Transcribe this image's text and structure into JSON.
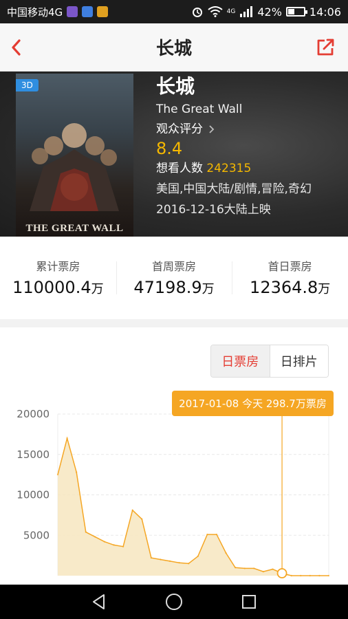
{
  "status_bar": {
    "carrier": "中国移动4G",
    "network": "4G",
    "battery": "42%",
    "battery_level": 0.42,
    "time": "14:06"
  },
  "nav": {
    "title": "长城"
  },
  "movie": {
    "badge": "3D",
    "poster_title": "THE GREAT WALL",
    "title_cn": "长城",
    "title_en": "The Great Wall",
    "rating_label": "观众评分",
    "rating": "8.4",
    "want_label": "想看人数",
    "want_count": "242315",
    "genre": "美国,中国大陆/剧情,冒险,奇幻",
    "release": "2016-12-16大陆上映"
  },
  "stats": [
    {
      "label": "累计票房",
      "value": "110000.4",
      "unit": "万"
    },
    {
      "label": "首周票房",
      "value": "47198.9",
      "unit": "万"
    },
    {
      "label": "首日票房",
      "value": "12364.8",
      "unit": "万"
    }
  ],
  "tabs": {
    "daily_box": "日票房",
    "daily_schedule": "日排片"
  },
  "tooltip": "2017-01-08 今天 298.7万票房",
  "colors": {
    "accent": "#e43d33",
    "rating": "#f5b800",
    "chart_line": "#f5a623",
    "chart_fill": "#f7e6bf"
  },
  "chart_data": {
    "type": "area",
    "ylim": [
      0,
      20000
    ],
    "yticks": [
      20000,
      15000,
      10000,
      5000
    ],
    "values": [
      12500,
      17000,
      12800,
      5400,
      4800,
      4200,
      3800,
      3600,
      8100,
      7000,
      2200,
      2000,
      1800,
      1600,
      1500,
      2400,
      5100,
      5100,
      2800,
      1000,
      900,
      900,
      500,
      800,
      298.7,
      0,
      0,
      0,
      0,
      0
    ],
    "highlight_index": 24
  }
}
